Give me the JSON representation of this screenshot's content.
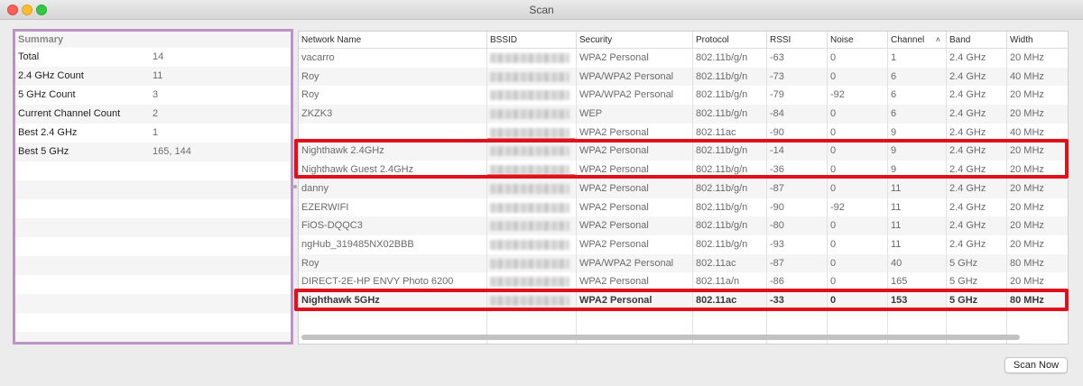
{
  "window": {
    "title": "Scan"
  },
  "summary": {
    "title": "Summary",
    "rows": [
      {
        "label": "Total",
        "value": "14"
      },
      {
        "label": "2.4 GHz Count",
        "value": "11"
      },
      {
        "label": "5 GHz Count",
        "value": "3"
      },
      {
        "label": "Current Channel Count",
        "value": "2"
      },
      {
        "label": "Best 2.4 GHz",
        "value": "1"
      },
      {
        "label": "Best 5 GHz",
        "value": "165, 144"
      }
    ]
  },
  "table": {
    "columns": [
      {
        "key": "network",
        "label": "Network Name"
      },
      {
        "key": "bssid",
        "label": "BSSID"
      },
      {
        "key": "security",
        "label": "Security"
      },
      {
        "key": "protocol",
        "label": "Protocol"
      },
      {
        "key": "rssi",
        "label": "RSSI"
      },
      {
        "key": "noise",
        "label": "Noise"
      },
      {
        "key": "channel",
        "label": "Channel",
        "sorted": "ascending"
      },
      {
        "key": "band",
        "label": "Band"
      },
      {
        "key": "width",
        "label": "Width"
      }
    ],
    "rows": [
      {
        "network": "vacarro",
        "security": "WPA2 Personal",
        "protocol": "802.11b/g/n",
        "rssi": "-63",
        "noise": "0",
        "channel": "1",
        "band": "2.4 GHz",
        "width": "20 MHz"
      },
      {
        "network": "Roy",
        "security": "WPA/WPA2 Personal",
        "protocol": "802.11b/g/n",
        "rssi": "-73",
        "noise": "0",
        "channel": "6",
        "band": "2.4 GHz",
        "width": "40 MHz"
      },
      {
        "network": "Roy",
        "security": "WPA/WPA2 Personal",
        "protocol": "802.11b/g/n",
        "rssi": "-79",
        "noise": "-92",
        "channel": "6",
        "band": "2.4 GHz",
        "width": "20 MHz"
      },
      {
        "network": "ZKZK3",
        "security": "WEP",
        "protocol": "802.11b/g/n",
        "rssi": "-84",
        "noise": "0",
        "channel": "6",
        "band": "2.4 GHz",
        "width": "20 MHz"
      },
      {
        "network": "",
        "security": "WPA2 Personal",
        "protocol": "802.11ac",
        "rssi": "-90",
        "noise": "0",
        "channel": "9",
        "band": "2.4 GHz",
        "width": "40 MHz"
      },
      {
        "network": "Nighthawk 2.4GHz",
        "security": "WPA2 Personal",
        "protocol": "802.11b/g/n",
        "rssi": "-14",
        "noise": "0",
        "channel": "9",
        "band": "2.4 GHz",
        "width": "20 MHz"
      },
      {
        "network": "Nighthawk Guest 2.4GHz",
        "security": "WPA2 Personal",
        "protocol": "802.11b/g/n",
        "rssi": "-36",
        "noise": "0",
        "channel": "9",
        "band": "2.4 GHz",
        "width": "20 MHz"
      },
      {
        "network": "danny",
        "security": "WPA2 Personal",
        "protocol": "802.11b/g/n",
        "rssi": "-87",
        "noise": "0",
        "channel": "11",
        "band": "2.4 GHz",
        "width": "20 MHz"
      },
      {
        "network": "EZERWIFI",
        "security": "WPA2 Personal",
        "protocol": "802.11b/g/n",
        "rssi": "-90",
        "noise": "-92",
        "channel": "11",
        "band": "2.4 GHz",
        "width": "20 MHz"
      },
      {
        "network": "FiOS-DQQC3",
        "security": "WPA2 Personal",
        "protocol": "802.11b/g/n",
        "rssi": "-80",
        "noise": "0",
        "channel": "11",
        "band": "2.4 GHz",
        "width": "20 MHz"
      },
      {
        "network": "ngHub_319485NX02BBB",
        "security": "WPA2 Personal",
        "protocol": "802.11b/g/n",
        "rssi": "-93",
        "noise": "0",
        "channel": "11",
        "band": "2.4 GHz",
        "width": "20 MHz"
      },
      {
        "network": "Roy",
        "security": "WPA/WPA2 Personal",
        "protocol": "802.11ac",
        "rssi": "-87",
        "noise": "0",
        "channel": "40",
        "band": "5 GHz",
        "width": "80 MHz"
      },
      {
        "network": "DIRECT-2E-HP ENVY Photo 6200",
        "security": "WPA2 Personal",
        "protocol": "802.11a/n",
        "rssi": "-86",
        "noise": "0",
        "channel": "165",
        "band": "5 GHz",
        "width": "20 MHz"
      },
      {
        "network": "Nighthawk 5GHz",
        "security": "WPA2 Personal",
        "protocol": "802.11ac",
        "rssi": "-33",
        "noise": "0",
        "channel": "153",
        "band": "5 GHz",
        "width": "80 MHz",
        "bold": true
      }
    ]
  },
  "buttons": {
    "scan_now": "Scan Now"
  },
  "colors": {
    "highlight": "#e0111a",
    "summary_border": "#b995c2"
  }
}
